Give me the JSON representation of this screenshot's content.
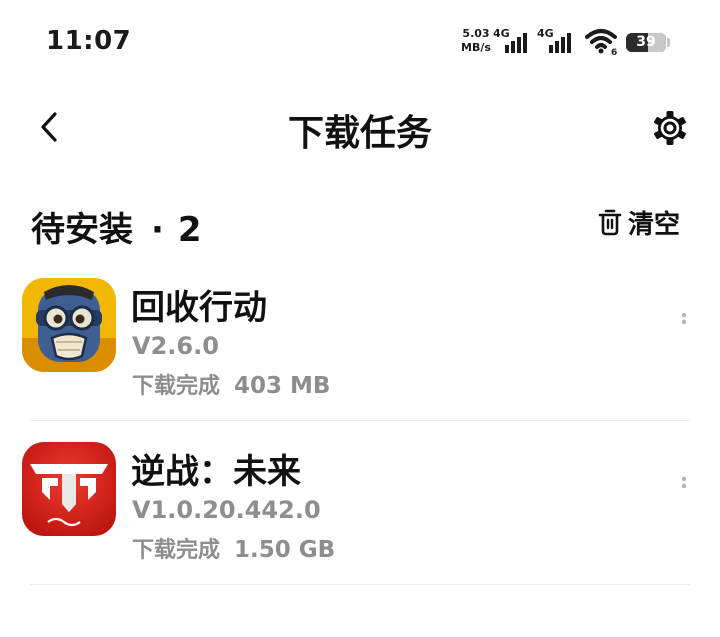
{
  "status_bar": {
    "time": "11:07",
    "net_speed_value": "5.03",
    "net_speed_unit": "MB/s",
    "sim1_label": "4G",
    "sim2_label": "4G",
    "wifi_label": "6",
    "battery_level": "39",
    "battery_fraction": 0.39
  },
  "header": {
    "title": "下载任务",
    "back_icon": "chevron-left-icon",
    "settings_icon": "gear-icon"
  },
  "section": {
    "title": "待安装",
    "separator": "·",
    "count": "2",
    "clear_label": "清空",
    "clear_icon": "trash-icon"
  },
  "tasks": [
    {
      "name": "回收行动",
      "version": "V2.6.0",
      "status": "下载完成",
      "size": "403 MB",
      "icon": "game-character-icon"
    },
    {
      "name": "逆战：未来",
      "version": "V1.0.20.442.0",
      "status": "下载完成",
      "size": "1.50 GB",
      "icon": "game-logo-icon"
    }
  ],
  "colors": {
    "text_primary": "#111111",
    "text_secondary": "#8e8e8e",
    "divider": "#ebebeb",
    "icon2_red": "#d9231e"
  }
}
